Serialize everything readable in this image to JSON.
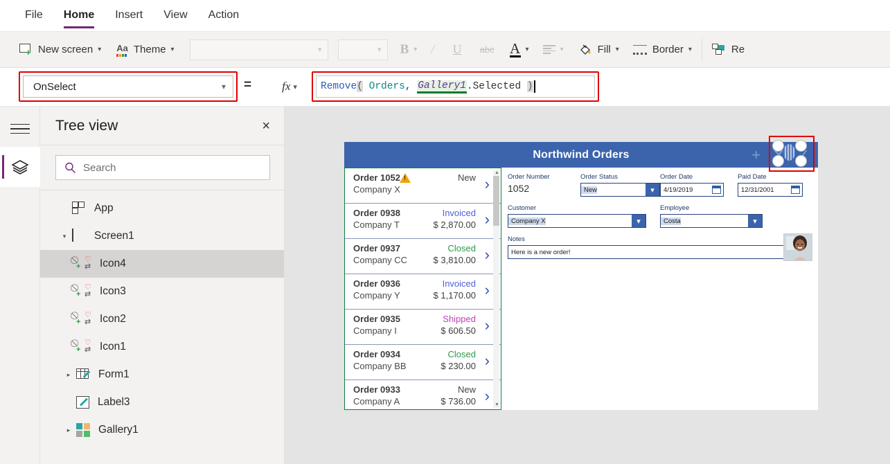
{
  "menu": {
    "items": [
      {
        "label": "File",
        "active": false
      },
      {
        "label": "Home",
        "active": true
      },
      {
        "label": "Insert",
        "active": false
      },
      {
        "label": "View",
        "active": false
      },
      {
        "label": "Action",
        "active": false
      }
    ]
  },
  "ribbon": {
    "new_screen": "New screen",
    "theme": "Theme",
    "font_name": "",
    "font_size": "",
    "bold": "B",
    "italic": "I",
    "underline": "U",
    "strikethrough": "abc",
    "font_color": "A",
    "fill": "Fill",
    "border": "Border",
    "reorder": "Re"
  },
  "formula_bar": {
    "property": "OnSelect",
    "equals": "=",
    "fx": "fx",
    "formula_tokens": [
      {
        "text": "Remove",
        "kind": "fn"
      },
      {
        "text": "(",
        "kind": "paren"
      },
      {
        "text": " Orders",
        "kind": "tbl"
      },
      {
        "text": ", ",
        "kind": "punc"
      },
      {
        "text": "Gallery1",
        "kind": "ctrl"
      },
      {
        "text": ".Selected ",
        "kind": "prop"
      },
      {
        "text": ")",
        "kind": "paren"
      }
    ],
    "formula_plain": "Remove( Orders, Gallery1.Selected )"
  },
  "tree": {
    "title": "Tree view",
    "close": "×",
    "search_placeholder": "Search",
    "search_value": "",
    "items": [
      {
        "label": "App",
        "icon": "app-icon",
        "indent": 0,
        "caret": "",
        "selected": false
      },
      {
        "label": "Screen1",
        "icon": "screen-icon",
        "indent": 0,
        "caret": "▾",
        "selected": false
      },
      {
        "label": "Icon4",
        "icon": "quad-icon",
        "indent": 1,
        "caret": "",
        "selected": true
      },
      {
        "label": "Icon3",
        "icon": "quad-icon",
        "indent": 1,
        "caret": "",
        "selected": false
      },
      {
        "label": "Icon2",
        "icon": "quad-icon",
        "indent": 1,
        "caret": "",
        "selected": false
      },
      {
        "label": "Icon1",
        "icon": "quad-icon",
        "indent": 1,
        "caret": "",
        "selected": false
      },
      {
        "label": "Form1",
        "icon": "form-icon",
        "indent": 1,
        "caret": "▸",
        "selected": false
      },
      {
        "label": "Label3",
        "icon": "label-icon",
        "indent": 1,
        "caret": "",
        "selected": false
      },
      {
        "label": "Gallery1",
        "icon": "gallery-icon",
        "indent": 1,
        "caret": "▸",
        "selected": false
      }
    ]
  },
  "app": {
    "title": "Northwind Orders",
    "header_actions": [
      "+",
      "✕",
      "✓"
    ],
    "gallery": {
      "rows": [
        {
          "order": "Order 1052",
          "company": "Company X",
          "status": "New",
          "amount": "",
          "warn": true,
          "status_color": "#444444"
        },
        {
          "order": "Order 0938",
          "company": "Company T",
          "status": "Invoiced",
          "amount": "$ 2,870.00",
          "warn": false,
          "status_color": "#4f5fd7"
        },
        {
          "order": "Order 0937",
          "company": "Company CC",
          "status": "Closed",
          "amount": "$ 3,810.00",
          "warn": false,
          "status_color": "#2e9947"
        },
        {
          "order": "Order 0936",
          "company": "Company Y",
          "status": "Invoiced",
          "amount": "$ 1,170.00",
          "warn": false,
          "status_color": "#4f5fd7"
        },
        {
          "order": "Order 0935",
          "company": "Company I",
          "status": "Shipped",
          "amount": "$ 606.50",
          "warn": false,
          "status_color": "#c23fb8"
        },
        {
          "order": "Order 0934",
          "company": "Company BB",
          "status": "Closed",
          "amount": "$ 230.00",
          "warn": false,
          "status_color": "#2e9947"
        },
        {
          "order": "Order 0933",
          "company": "Company A",
          "status": "New",
          "amount": "$ 736.00",
          "warn": false,
          "status_color": "#444444"
        }
      ],
      "chevron": "›"
    },
    "form": {
      "order_number_label": "Order Number",
      "order_number_value": "1052",
      "order_status_label": "Order Status",
      "order_status_value": "New",
      "order_date_label": "Order Date",
      "order_date_value": "4/19/2019",
      "paid_date_label": "Paid Date",
      "paid_date_value": "12/31/2001",
      "customer_label": "Customer",
      "customer_value": "Company X",
      "employee_label": "Employee",
      "employee_value": "Costa",
      "notes_label": "Notes",
      "notes_value": "Here is a new order!"
    }
  },
  "colors": {
    "accent_purple": "#742774",
    "app_blue": "#3c64ac",
    "highlight_red": "#e00000",
    "gallery_green": "#107c41"
  }
}
